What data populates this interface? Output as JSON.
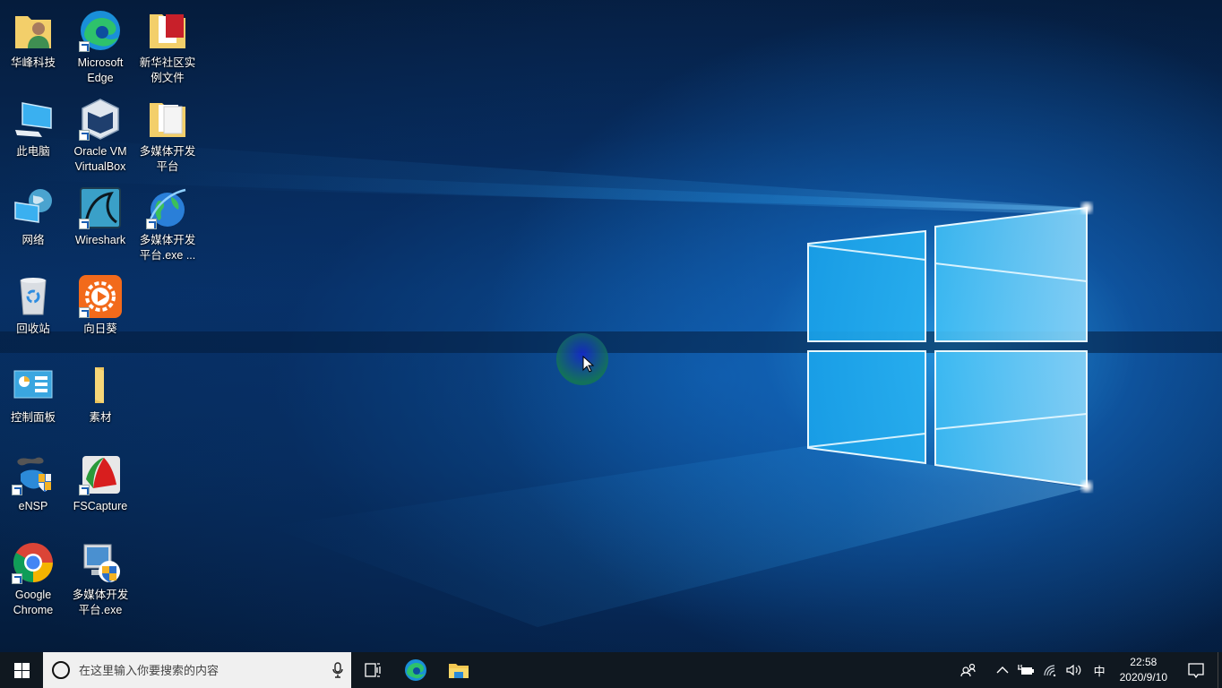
{
  "desktop": {
    "icons": [
      {
        "label": "华峰科技",
        "icon": "user-folder-icon",
        "shortcut": false
      },
      {
        "label": "Microsoft\nEdge",
        "icon": "edge-icon",
        "shortcut": true
      },
      {
        "label": "新华社区实\n例文件",
        "icon": "document-folder-icon",
        "shortcut": false
      },
      {
        "label": "此电脑",
        "icon": "this-pc-icon",
        "shortcut": false
      },
      {
        "label": "Oracle VM\nVirtualBox",
        "icon": "virtualbox-icon",
        "shortcut": true
      },
      {
        "label": "多媒体开发\n平台",
        "icon": "document-folder-icon",
        "shortcut": false
      },
      {
        "label": "网络",
        "icon": "network-icon",
        "shortcut": false
      },
      {
        "label": "Wireshark",
        "icon": "wireshark-icon",
        "shortcut": true
      },
      {
        "label": "多媒体开发\n平台.exe ...",
        "icon": "globe-icon",
        "shortcut": true
      },
      {
        "label": "回收站",
        "icon": "recycle-bin-icon",
        "shortcut": false
      },
      {
        "label": "向日葵",
        "icon": "sunlogin-icon",
        "shortcut": true
      },
      {
        "label": "控制面板",
        "icon": "control-panel-icon",
        "shortcut": false
      },
      {
        "label": "素材",
        "icon": "folder-icon",
        "shortcut": false
      },
      {
        "label": "eNSP",
        "icon": "ensp-icon",
        "shortcut": true
      },
      {
        "label": "FSCapture",
        "icon": "fscapture-icon",
        "shortcut": true
      },
      {
        "label": "Google\nChrome",
        "icon": "chrome-icon",
        "shortcut": true
      },
      {
        "label": "多媒体开发\n平台.exe",
        "icon": "monitor-shield-icon",
        "shortcut": false
      }
    ]
  },
  "taskbar": {
    "search_placeholder": "在这里输入你要搜索的内容",
    "pinned": [
      {
        "name": "task-view",
        "icon": "task-view-icon"
      },
      {
        "name": "microsoft-edge",
        "icon": "edge-icon"
      },
      {
        "name": "file-explorer",
        "icon": "file-explorer-icon"
      }
    ],
    "tray": {
      "input_method": "中",
      "time": "22:58",
      "date": "2020/9/10"
    }
  },
  "colors": {
    "taskbar_bg": "#101820",
    "search_bg": "#f0f0f0",
    "wallpaper_accent": "#1e90e0"
  }
}
